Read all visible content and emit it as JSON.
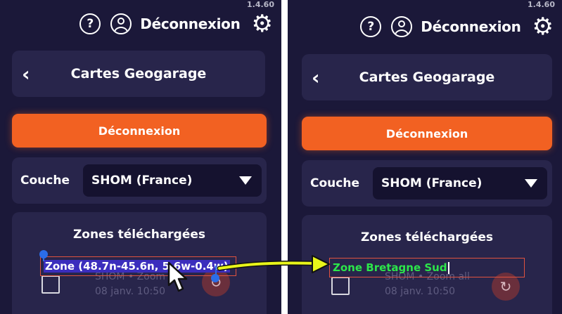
{
  "version": "1.4.60",
  "header": {
    "help_icon": "help-circle-icon",
    "user_icon": "user-circle-icon",
    "logout_label": "Déconnexion",
    "settings_icon": "gear-icon"
  },
  "title_card": {
    "back_icon": "chevron-left-icon",
    "title": "Cartes Geogarage"
  },
  "logout_button": "Déconnexion",
  "layer": {
    "label": "Couche",
    "selected": "SHOM (France)"
  },
  "zones": {
    "title": "Zones téléchargées",
    "item": {
      "source": "SHOM • Zoom all",
      "date": "08 janv. 10:50",
      "refresh_icon": "refresh-icon"
    }
  },
  "edit_before": {
    "name": "Zone (48.7n-45.6n, 5.6w-0.4w)"
  },
  "edit_after": {
    "name": "Zone Bretagne Sud"
  },
  "colors": {
    "background": "#1b1839",
    "card": "#28254b",
    "accent": "#f26122",
    "new_text": "#2ce64a",
    "arrow": "#e8f51a"
  }
}
